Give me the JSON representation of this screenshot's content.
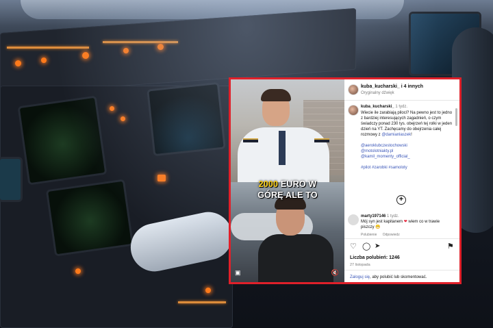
{
  "post": {
    "header": {
      "author_line": "kuba_kucharski_ i 4 innych",
      "audio": "Oryginalny dźwięk"
    },
    "video": {
      "caption_line1_highlight": "2000",
      "caption_line1_rest": " EURO W",
      "caption_line2": "GÓRĘ ALE TO"
    },
    "comment_main": {
      "username": "kuba_kucharski_",
      "time": "1 tydz.",
      "text": "Wiecie ile zarabiają piloci? Na pewno jest to jedno z bardziej interesujących zagadnień, o czym świadczy ponad 230 tys. obejrzeń tej rolki w jeden dzień na YT. Zachęcamy do obejrzenia całej rozmowy z",
      "mention": "@damianlaszek",
      "tail": "!",
      "tags": [
        "@aeroklubczestochowski",
        "@motolotniakty.pl",
        "@kamil_momenty_official_"
      ],
      "hashtags": "#pilot #zarobki #samoloty"
    },
    "comment_reply": {
      "username": "marty197146",
      "time": "1 tydz.",
      "text": "Mój syn jest kapitanem",
      "text_after": " wiem co w trawie piszczy",
      "likes_label": "Polubienie",
      "reply_label": "Odpowiedz"
    },
    "likes": "Liczba polubień: 1246",
    "date": "27 listopada",
    "footer_link": "Zaloguj się",
    "footer_text": ", aby polubić lub skomentować."
  },
  "colors": {
    "frame": "#e0202a",
    "link": "#3a56b8",
    "highlight": "#ffd21a"
  },
  "icons": [
    "heart-icon",
    "comment-icon",
    "share-icon",
    "bookmark-icon",
    "add-icon",
    "mute-icon",
    "instagram-logo-icon"
  ]
}
